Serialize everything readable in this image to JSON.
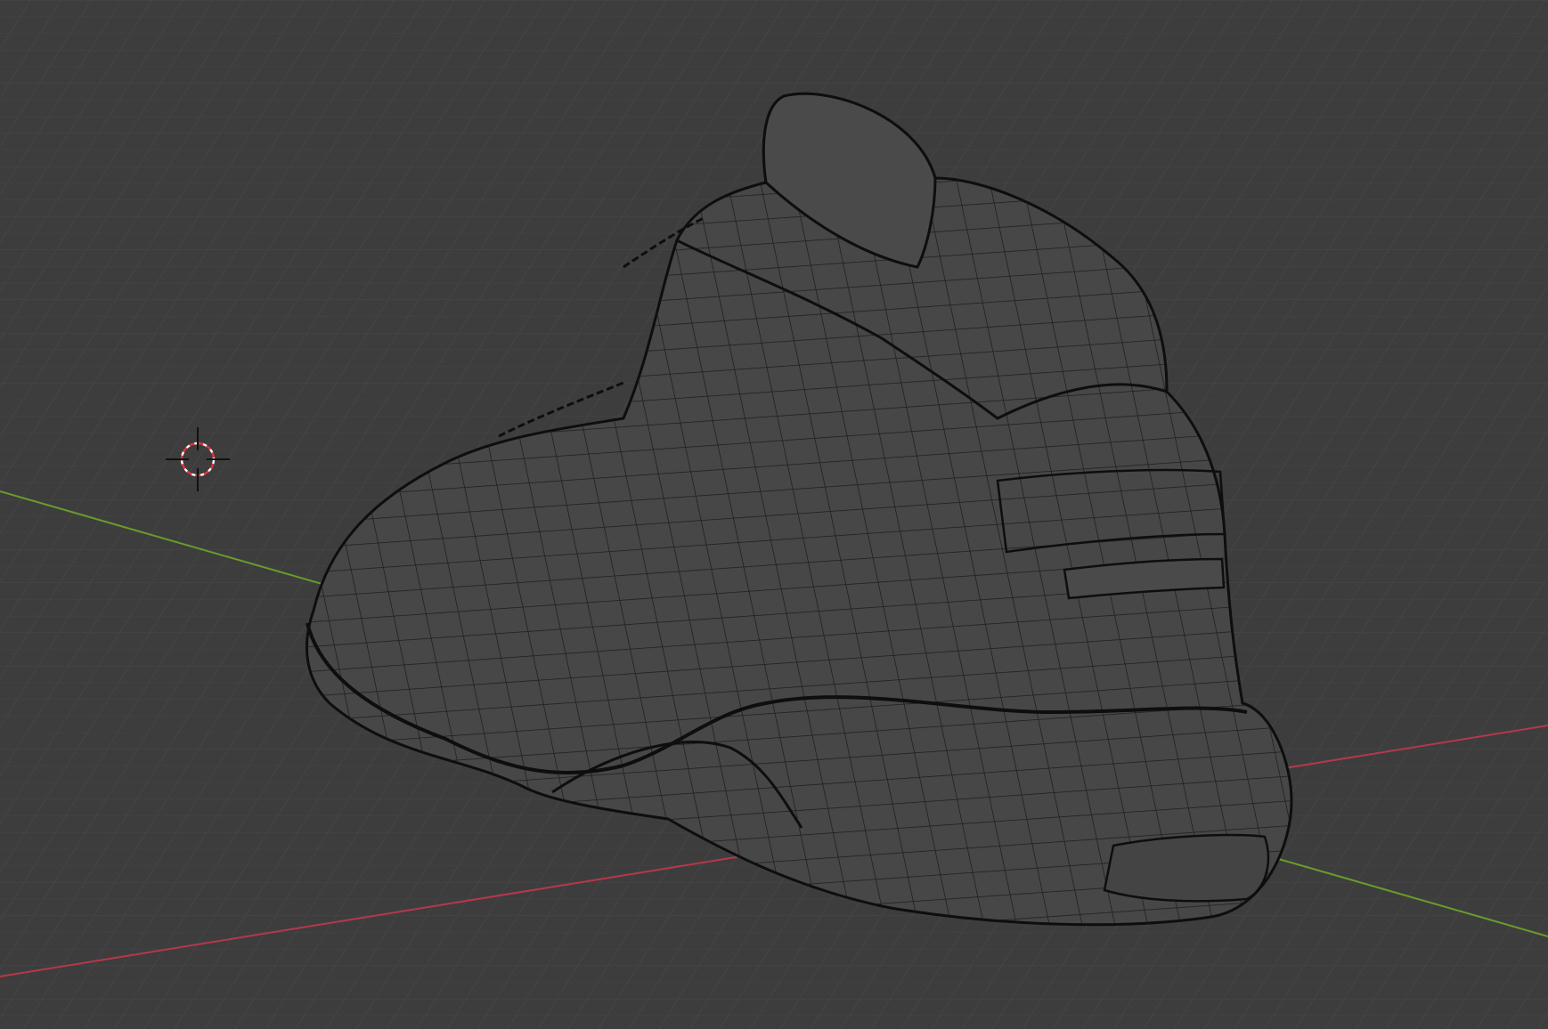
{
  "viewport": {
    "mode": "3d-viewport",
    "shading": "solid-wireframe-overlay",
    "object": "sneaker-mesh",
    "colors": {
      "background": "#3d3d3d",
      "grid_line": "#474747",
      "x_axis": "#b5384a",
      "y_axis": "#6a9b2d",
      "mesh_fill": "#474747",
      "mesh_wire": "#111111",
      "cursor_red": "#e0323c",
      "cursor_white": "#ffffff"
    },
    "icons": {
      "cursor": "3d-cursor-icon"
    }
  }
}
